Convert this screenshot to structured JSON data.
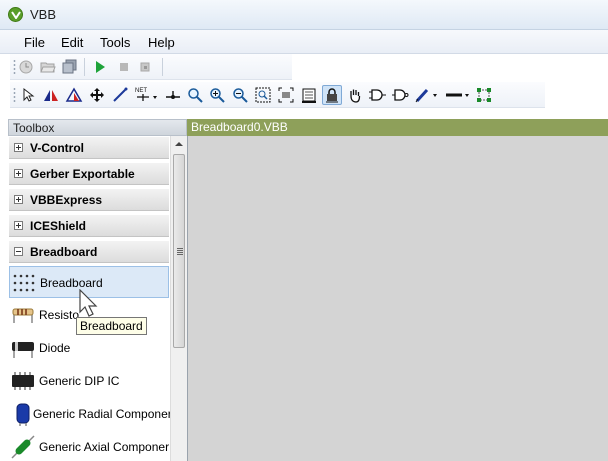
{
  "window": {
    "title": "VBB"
  },
  "menu": [
    "File",
    "Edit",
    "Tools",
    "Help"
  ],
  "toolbar_main": [
    {
      "name": "new-icon"
    },
    {
      "name": "open-icon"
    },
    {
      "name": "save-icon"
    },
    {
      "name": "run-icon"
    },
    {
      "name": "stop-icon"
    },
    {
      "name": "step-icon"
    }
  ],
  "toolbar_tools": [
    {
      "name": "select-icon"
    },
    {
      "name": "flip-horizontal-icon"
    },
    {
      "name": "flip-vertical-icon"
    },
    {
      "name": "move-icon"
    },
    {
      "name": "wire-icon"
    },
    {
      "name": "net-icon",
      "label": "NET"
    },
    {
      "name": "junction-icon"
    },
    {
      "name": "zoom-icon"
    },
    {
      "name": "zoom-in-icon"
    },
    {
      "name": "zoom-out-icon"
    },
    {
      "name": "zoom-fit-icon"
    },
    {
      "name": "zoom-selection-icon"
    },
    {
      "name": "zoom-page-icon"
    },
    {
      "name": "lock-icon"
    },
    {
      "name": "pan-icon"
    },
    {
      "name": "gate-icon"
    },
    {
      "name": "gate-buffer-icon"
    },
    {
      "name": "pen-icon"
    },
    {
      "name": "line-style-icon"
    },
    {
      "name": "resize-icon"
    }
  ],
  "toolbox": {
    "title": "Toolbox",
    "categories": [
      {
        "label": "V-Control",
        "expanded": false
      },
      {
        "label": "Gerber Exportable",
        "expanded": false
      },
      {
        "label": "VBBExpress",
        "expanded": false
      },
      {
        "label": "ICEShield",
        "expanded": false
      },
      {
        "label": "Breadboard",
        "expanded": true
      }
    ],
    "items": [
      {
        "label": "Breadboard",
        "icon": "breadboard-icon",
        "selected": true
      },
      {
        "label": "Resisto",
        "icon": "resistor-icon"
      },
      {
        "label": "Diode",
        "icon": "diode-icon"
      },
      {
        "label": "Generic DIP IC",
        "icon": "dip-ic-icon"
      },
      {
        "label": "Generic Radial Componer",
        "icon": "radial-component-icon"
      },
      {
        "label": "Generic Axial Componer",
        "icon": "axial-component-icon"
      }
    ]
  },
  "document": {
    "tab_title": "Breadboard0.VBB"
  },
  "tooltip": {
    "text": "Breadboard"
  },
  "colors": {
    "doc_tab": "#8ea05a",
    "canvas": "#d4d4d4",
    "selection": "#dce9f7"
  }
}
